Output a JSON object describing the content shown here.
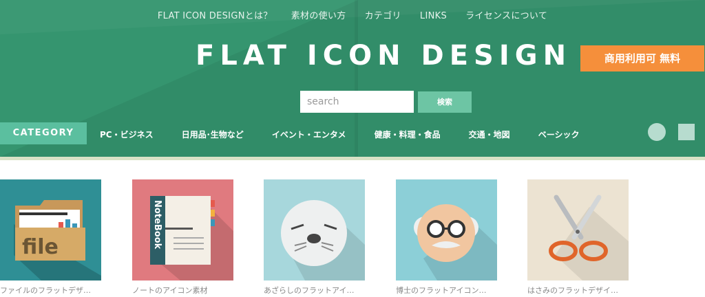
{
  "topnav": {
    "items": [
      "FLAT ICON DESIGNとは？",
      "素材の使い方",
      "カテゴリ",
      "LINKS",
      "ライセンスについて"
    ]
  },
  "header": {
    "logo": "FLAT ICON DESIGN",
    "badge": "商用利用可 無料"
  },
  "search": {
    "placeholder": "search",
    "button": "検索"
  },
  "category_nav": {
    "label": "CATEGORY",
    "items": [
      "PC・ビジネス",
      "日用品･生物など",
      "イベント・エンタメ",
      "健康・料理・食品",
      "交通・地図",
      "ベーシック"
    ]
  },
  "icons": {
    "file_text": "file",
    "notebook_text": "NoteBook"
  },
  "cards": [
    {
      "caption": "ファイルのフラットデザ…",
      "bg": "#2f8f95"
    },
    {
      "caption": "ノートのアイコン素材",
      "bg": "#e07a7f"
    },
    {
      "caption": "あざらしのフラットアイ…",
      "bg": "#a7d7dc"
    },
    {
      "caption": "博士のフラットアイコン…",
      "bg": "#8ccfd7"
    },
    {
      "caption": "はさみのフラットデザイ…",
      "bg": "#ece3d2"
    }
  ],
  "colors": {
    "header_bg": "#35956f",
    "badge_bg": "#f58f3b",
    "category_label_bg": "#5bbf9f",
    "search_button_bg": "#6dc5a4"
  }
}
